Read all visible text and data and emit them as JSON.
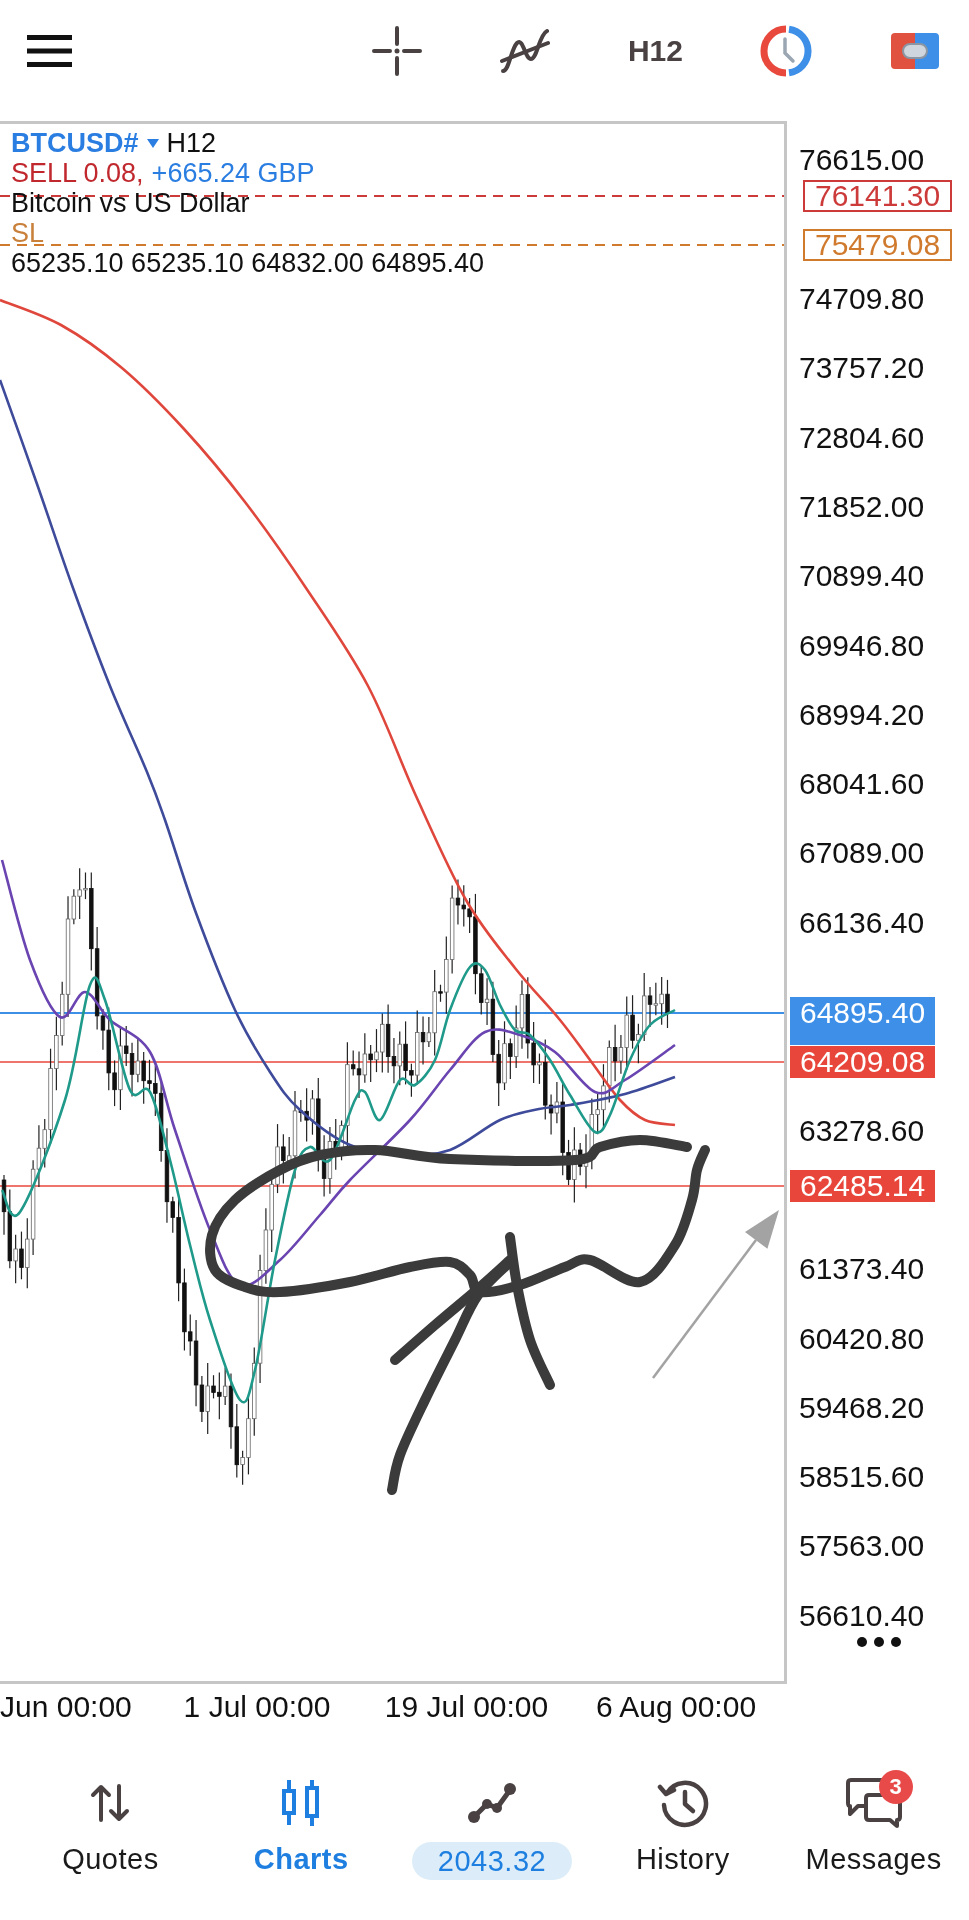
{
  "toolbar": {
    "timeframe": "H12"
  },
  "chart": {
    "symbol": "BTCUSD#",
    "timeframe": "H12",
    "position": "SELL 0.08,",
    "profit": "+665.24 GBP",
    "description": "Bitcoin vs US Dollar",
    "stop_loss_label": "SL",
    "ohlc": "65235.10 65235.10 64832.00 64895.40",
    "price_axis": [
      "76615.00",
      "74709.80",
      "73757.20",
      "72804.60",
      "71852.00",
      "70899.40",
      "69946.80",
      "68994.20",
      "68041.60",
      "67089.00",
      "66136.40",
      "63278.60",
      "61373.40",
      "60420.80",
      "59468.20",
      "58515.60",
      "57563.00",
      "56610.40"
    ],
    "time_axis": [
      "Jun 00:00",
      "1 Jul 00:00",
      "19 Jul 00:00",
      "6 Aug 00:00"
    ],
    "price_tags": [
      {
        "text": "76141.30",
        "kind": "order",
        "color": "#cc3a3a"
      },
      {
        "text": "75479.08",
        "kind": "order",
        "color": "#d07a2e"
      },
      {
        "text": "64895.40",
        "kind": "bid",
        "color": "#3d8fe8"
      },
      {
        "text": "64209.08",
        "kind": "level",
        "color": "#e8463b"
      },
      {
        "text": "62485.14",
        "kind": "level",
        "color": "#e8463b"
      }
    ]
  },
  "nav": [
    {
      "label": "Quotes",
      "kind": "tab",
      "selected": false
    },
    {
      "label": "Charts",
      "kind": "tab",
      "selected": true
    },
    {
      "label": "2043.32",
      "kind": "balance",
      "selected": false
    },
    {
      "label": "History",
      "kind": "tab",
      "selected": false
    },
    {
      "label": "Messages",
      "kind": "tab",
      "selected": false,
      "badge": "3"
    }
  ]
}
